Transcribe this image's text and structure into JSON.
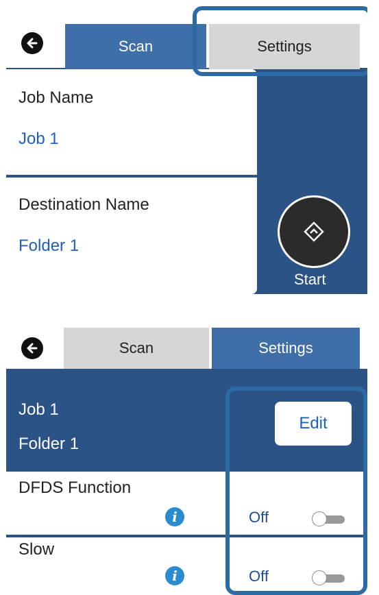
{
  "screen1": {
    "tabs": {
      "scan": "Scan",
      "settings": "Settings"
    },
    "job_name_label": "Job Name",
    "job_name_value": "Job 1",
    "destination_name_label": "Destination Name",
    "destination_name_value": "Folder 1",
    "start_label": "Start"
  },
  "screen2": {
    "tabs": {
      "scan": "Scan",
      "settings": "Settings"
    },
    "summary_job": "Job 1",
    "summary_folder": "Folder 1",
    "edit_label": "Edit",
    "dfds_label": "DFDS Function",
    "dfds_value": "Off",
    "slow_label": "Slow",
    "slow_value": "Off",
    "info_glyph": "i"
  },
  "colors": {
    "panel_blue": "#2b5386",
    "active_tab": "#3e6fa8",
    "inactive_tab": "#d6d6d6",
    "link_blue": "#1f5fbf",
    "highlight": "#2d6ba4"
  },
  "icons": [
    "back-arrow-icon",
    "scan-start-icon",
    "info-icon",
    "toggle-switch-icon"
  ]
}
